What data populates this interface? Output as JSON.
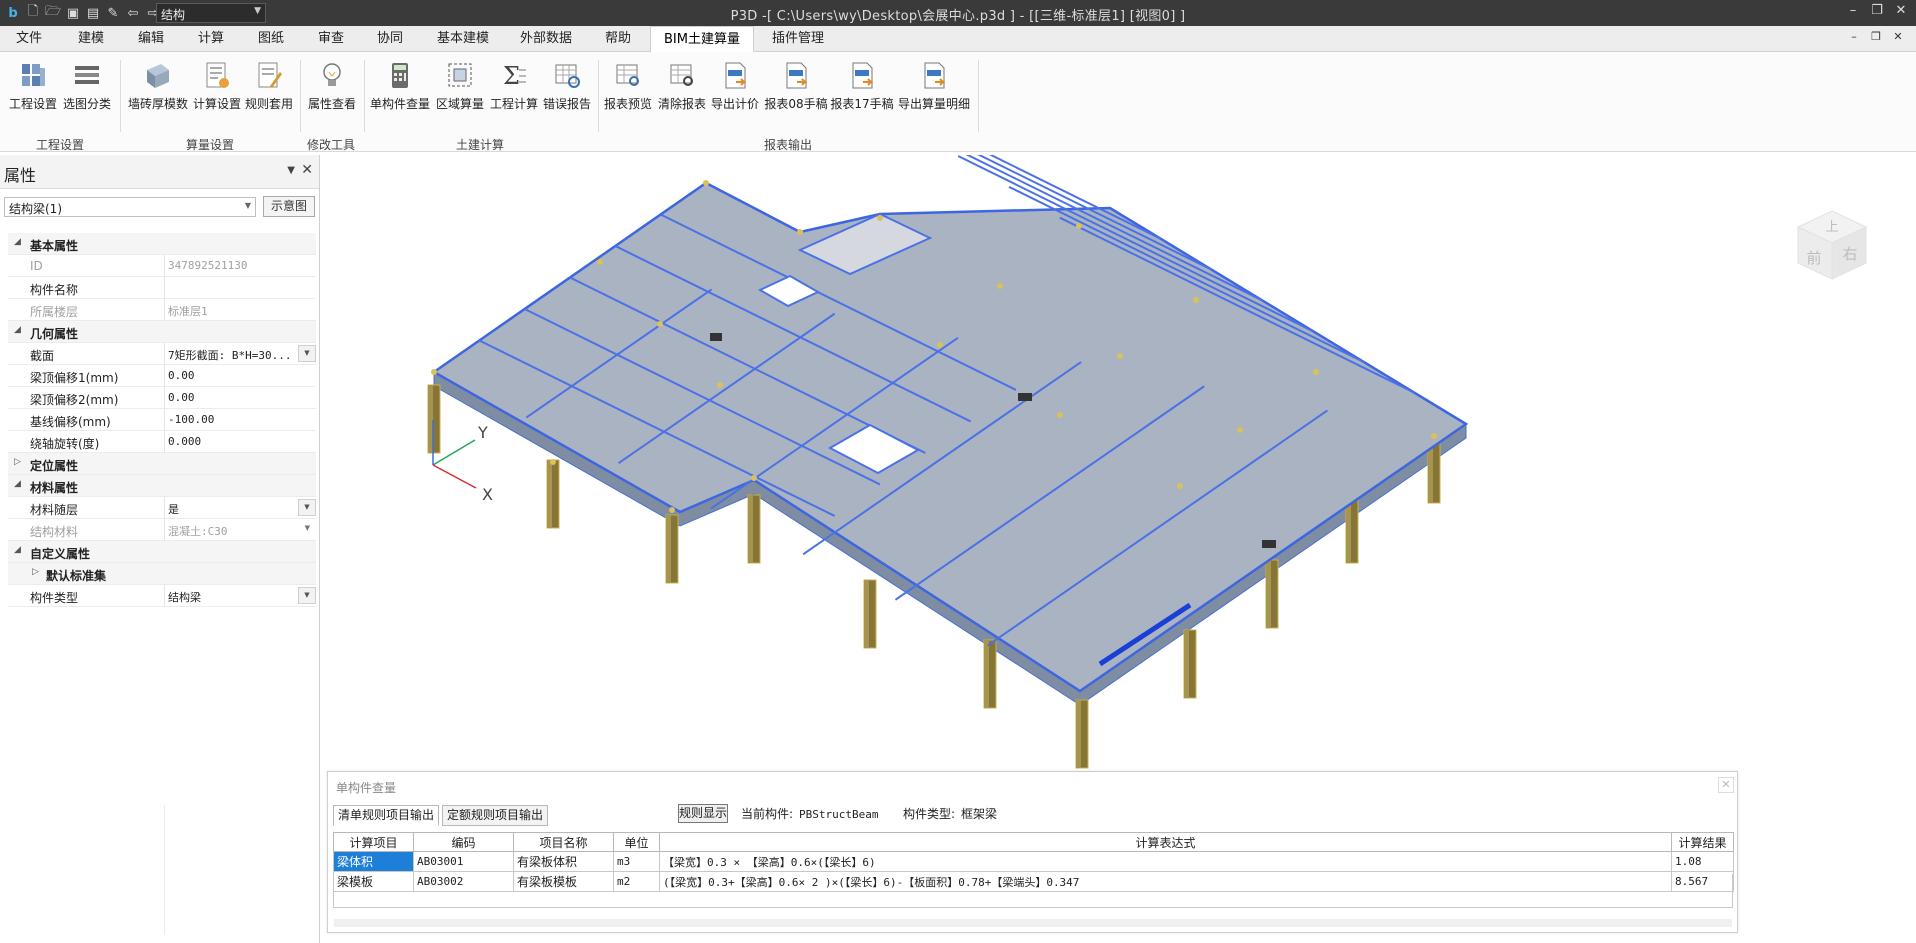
{
  "titlebar": {
    "layer_select": "结构",
    "title": "P3D -[ C:\\Users\\wy\\Desktop\\会展中心.p3d ] - [[三维-标准层1]  [视图0] ]"
  },
  "menu": {
    "items": [
      "文件",
      "建模",
      "编辑",
      "计算",
      "图纸",
      "审查",
      "协同",
      "基本建模",
      "外部数据",
      "帮助",
      "BIM土建算量",
      "插件管理"
    ],
    "active": "BIM土建算量"
  },
  "ribbon": {
    "buttons": [
      {
        "label": "工程设置",
        "icon": "project-settings-icon"
      },
      {
        "label": "选图分类",
        "icon": "layer-classify-icon"
      },
      {
        "label": "墙砖厚模数",
        "icon": "wall-brick-icon"
      },
      {
        "label": "计算设置",
        "icon": "calc-settings-icon"
      },
      {
        "label": "规则套用",
        "icon": "rule-apply-icon"
      },
      {
        "label": "属性查看",
        "icon": "lightbulb-icon"
      },
      {
        "label": "单构件查量",
        "icon": "calculator-icon"
      },
      {
        "label": "区域算量",
        "icon": "region-calc-icon"
      },
      {
        "label": "工程计算",
        "icon": "sigma-icon"
      },
      {
        "label": "错误报告",
        "icon": "error-report-icon"
      },
      {
        "label": "报表预览",
        "icon": "report-preview-icon"
      },
      {
        "label": "清除报表",
        "icon": "clear-report-icon"
      },
      {
        "label": "导出计价",
        "icon": "xml-export-icon"
      },
      {
        "label": "报表08手稿",
        "icon": "xls-08-icon"
      },
      {
        "label": "报表17手稿",
        "icon": "xls-17-icon"
      },
      {
        "label": "导出算量明细",
        "icon": "xml-detail-icon"
      }
    ],
    "groups": [
      "工程设置",
      "算量设置",
      "修改工具",
      "土建计算",
      "报表输出"
    ]
  },
  "props": {
    "title": "属性",
    "selector": "结构梁(1)",
    "diagram_btn": "示意图",
    "rows": [
      {
        "type": "cat",
        "name": "基本属性",
        "tog": "◢"
      },
      {
        "type": "row",
        "name": "ID",
        "value": "347892521130",
        "disabled": true
      },
      {
        "type": "row",
        "name": "构件名称",
        "value": ""
      },
      {
        "type": "row",
        "name": "所属楼层",
        "value": "标准层1",
        "disabled": true
      },
      {
        "type": "cat",
        "name": "几何属性",
        "tog": "◢"
      },
      {
        "type": "row",
        "name": "截面",
        "value": "7矩形截面: B*H=30...",
        "dd": "btn"
      },
      {
        "type": "row",
        "name": "梁顶偏移1(mm)",
        "value": "0.00"
      },
      {
        "type": "row",
        "name": "梁顶偏移2(mm)",
        "value": "0.00"
      },
      {
        "type": "row",
        "name": "基线偏移(mm)",
        "value": "-100.00"
      },
      {
        "type": "row",
        "name": "绕轴旋转(度)",
        "value": "0.000"
      },
      {
        "type": "cat",
        "name": "定位属性",
        "tog": "▷"
      },
      {
        "type": "cat",
        "name": "材料属性",
        "tog": "◢"
      },
      {
        "type": "row",
        "name": "材料随层",
        "value": "是",
        "dd": "btn"
      },
      {
        "type": "row",
        "name": "结构材料",
        "value": "混凝土:C30",
        "disabled": true,
        "dd": "arrow"
      },
      {
        "type": "cat",
        "name": "自定义属性",
        "tog": "◢"
      },
      {
        "type": "sub",
        "name": "默认标准集",
        "tog": "▷"
      },
      {
        "type": "row",
        "name": "构件类型",
        "value": "结构梁",
        "dd": "btn"
      }
    ]
  },
  "axis": {
    "y": "Y",
    "x": "X"
  },
  "viewcube": {
    "top": "上",
    "front": "前",
    "right": "右"
  },
  "qty_panel": {
    "title": "单构件查量",
    "tabs": [
      "清单规则项目输出",
      "定额规则项目输出"
    ],
    "rule_btn": "规则显示",
    "current_label": "当前构件:",
    "current_value": "PBStructBeam",
    "type_label": "构件类型:",
    "type_value": "框架梁",
    "columns": [
      "计算项目",
      "编码",
      "项目名称",
      "单位",
      "计算表达式",
      "计算结果"
    ],
    "rows": [
      [
        "梁体积",
        "AB03001",
        "有梁板体积",
        "m3",
        "【梁宽】0.3 × 【梁高】0.6×(【梁长】6)",
        "1.08"
      ],
      [
        "梁模板",
        "AB03002",
        "有梁板模板",
        "m2",
        "(【梁宽】0.3+【梁高】0.6× 2 )×(【梁长】6)-【板面积】0.78+【梁端头】0.347",
        "8.567"
      ]
    ]
  }
}
